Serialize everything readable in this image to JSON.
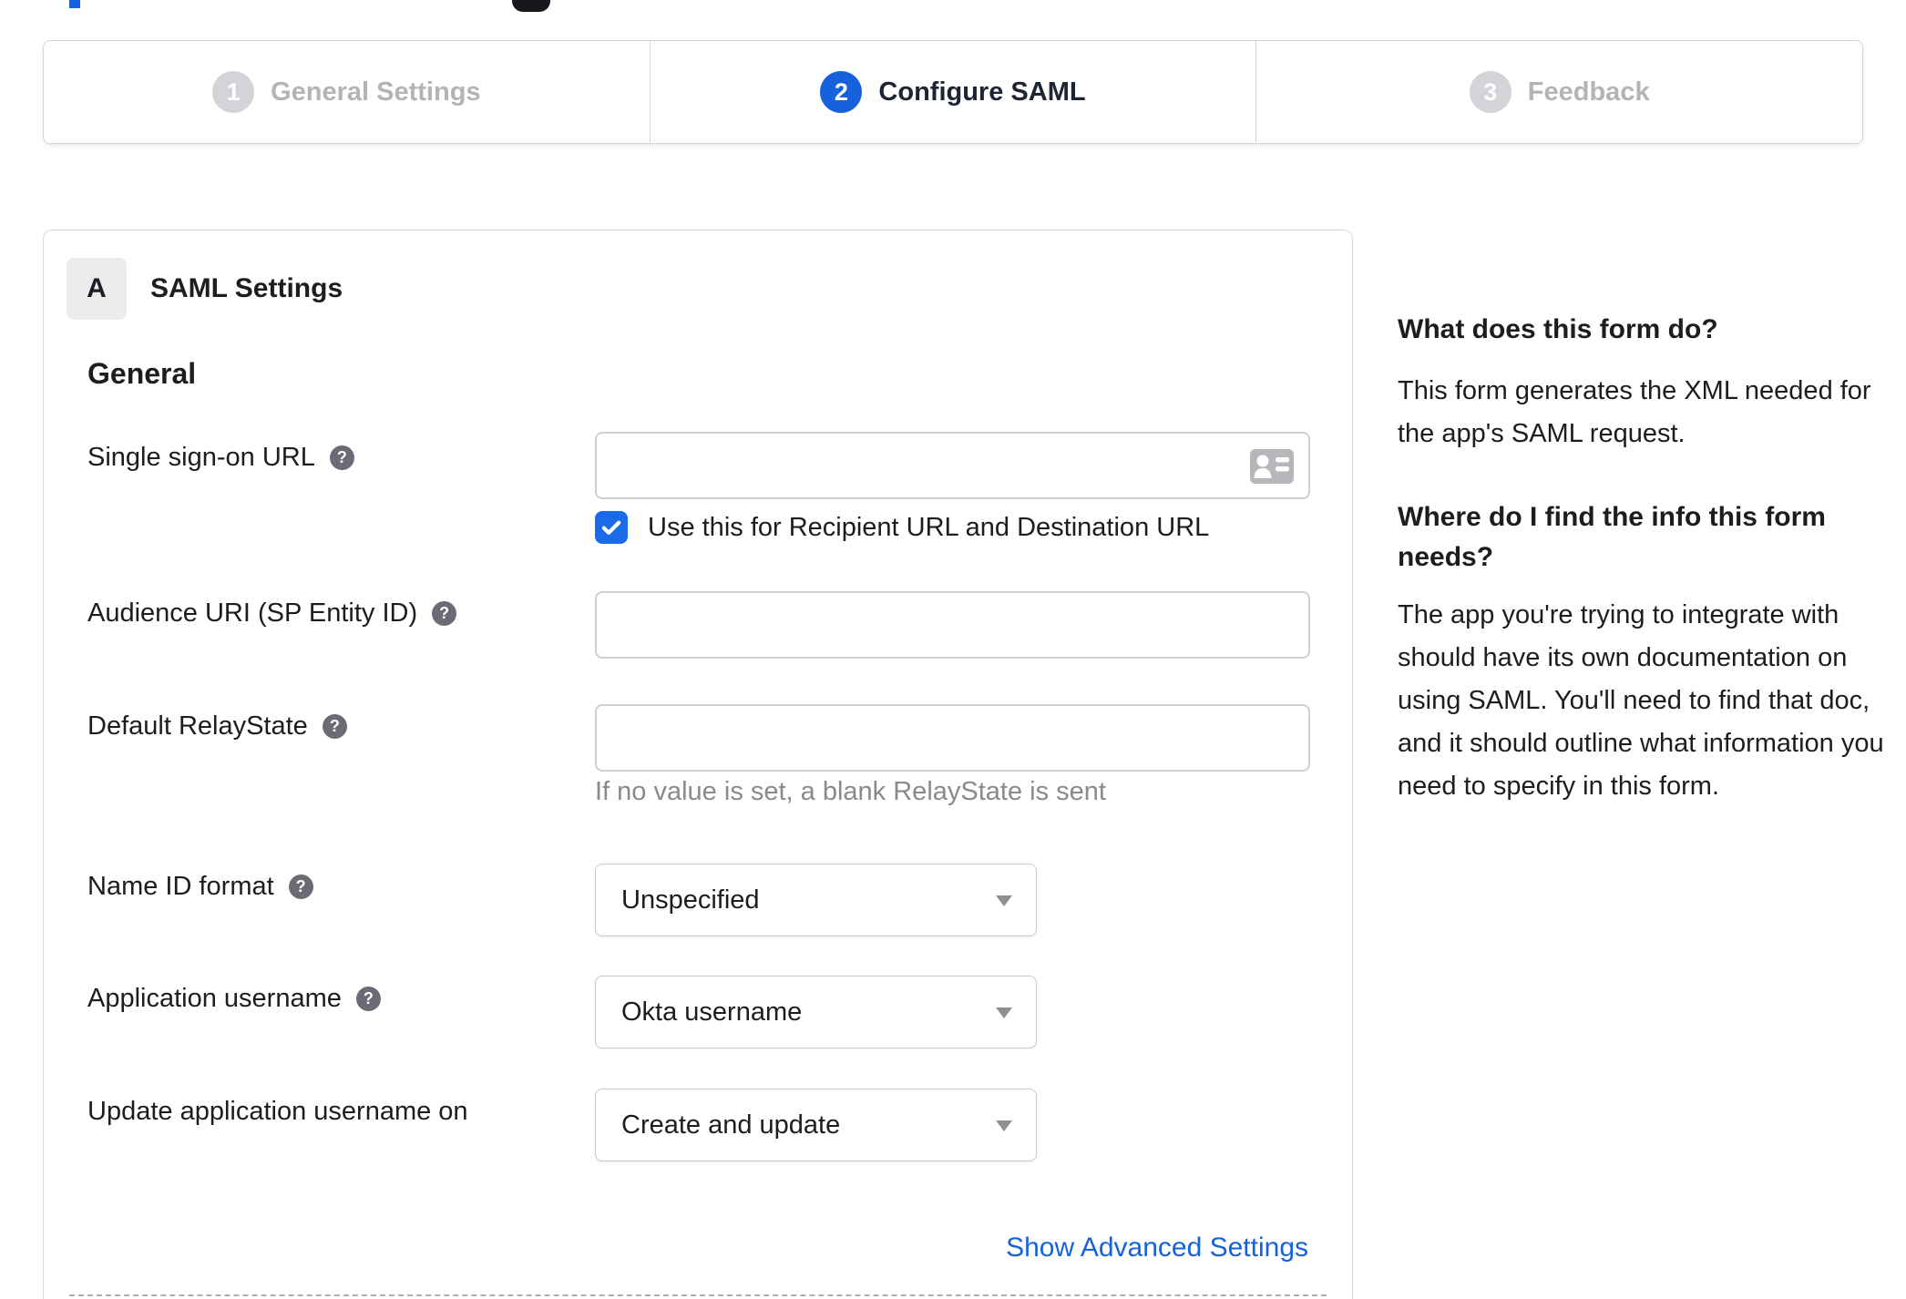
{
  "colors": {
    "accent": "#1662dd",
    "checkbox_blue": "#1a6bea",
    "inactive_step_gray": "#d4d4d8",
    "border_gray": "#d6d6da",
    "hint_gray": "#8a8a8e"
  },
  "stepper": {
    "steps": [
      {
        "number": "1",
        "label": "General Settings",
        "state": "inactive"
      },
      {
        "number": "2",
        "label": "Configure SAML",
        "state": "active"
      },
      {
        "number": "3",
        "label": "Feedback",
        "state": "inactive"
      }
    ]
  },
  "panel": {
    "section_badge": "A",
    "section_title": "SAML Settings",
    "group_title": "General",
    "fields": {
      "sso_url": {
        "label": "Single sign-on URL",
        "value": "",
        "has_help": true
      },
      "sso_checkbox": {
        "label": "Use this for Recipient URL and Destination URL",
        "checked": true
      },
      "audience_uri": {
        "label": "Audience URI (SP Entity ID)",
        "value": "",
        "has_help": true
      },
      "relay_state": {
        "label": "Default RelayState",
        "value": "",
        "has_help": true,
        "hint": "If no value is set, a blank RelayState is sent"
      },
      "name_id_format": {
        "label": "Name ID format",
        "value": "Unspecified",
        "has_help": true
      },
      "app_username": {
        "label": "Application username",
        "value": "Okta username",
        "has_help": true
      },
      "update_username": {
        "label": "Update application username on",
        "value": "Create and update",
        "has_help": false
      }
    },
    "advanced_link": "Show Advanced Settings"
  },
  "sidebar": {
    "sections": [
      {
        "heading": "What does this form do?",
        "body": "This form generates the XML needed for the app's SAML request."
      },
      {
        "heading": "Where do I find the info this form needs?",
        "body": "The app you're trying to integrate with should have its own documentation on using SAML. You'll need to find that doc, and it should outline what information you need to specify in this form."
      }
    ]
  }
}
